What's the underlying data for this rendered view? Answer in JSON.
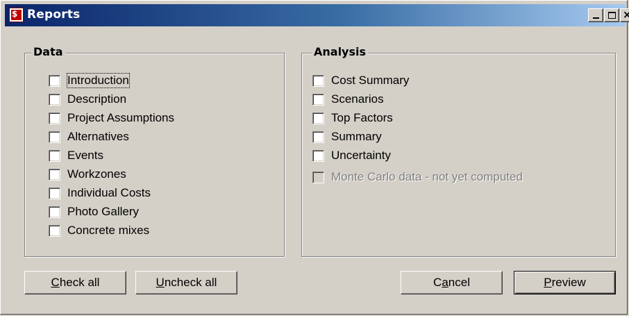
{
  "window": {
    "title": "Reports",
    "icon": "app-logo-icon",
    "controls": [
      "minimize-icon",
      "maximize-icon",
      "close-icon"
    ]
  },
  "data_group": {
    "legend": "Data",
    "items": [
      {
        "label": "Introduction",
        "checked": false,
        "focused": true
      },
      {
        "label": "Description",
        "checked": false
      },
      {
        "label": "Project Assumptions",
        "checked": false
      },
      {
        "label": "Alternatives",
        "checked": false
      },
      {
        "label": "Events",
        "checked": false
      },
      {
        "label": "Workzones",
        "checked": false
      },
      {
        "label": "Individual Costs",
        "checked": false
      },
      {
        "label": "Photo Gallery",
        "checked": false
      },
      {
        "label": "Concrete mixes",
        "checked": false
      }
    ]
  },
  "analysis_group": {
    "legend": "Analysis",
    "items": [
      {
        "label": "Cost Summary",
        "checked": false
      },
      {
        "label": "Scenarios",
        "checked": false
      },
      {
        "label": "Top Factors",
        "checked": false
      },
      {
        "label": "Summary",
        "checked": false
      },
      {
        "label": "Uncertainty",
        "checked": false
      },
      {
        "label": "Monte Carlo data - not yet computed",
        "checked": false,
        "disabled": true
      }
    ]
  },
  "buttons": {
    "check_all": {
      "mnemonic": "C",
      "rest": "heck all"
    },
    "uncheck_all": {
      "mnemonic": "U",
      "rest": "ncheck all"
    },
    "cancel": {
      "pre": "C",
      "mnemonic": "a",
      "rest": "ncel"
    },
    "preview": {
      "mnemonic": "P",
      "rest": "review"
    }
  }
}
